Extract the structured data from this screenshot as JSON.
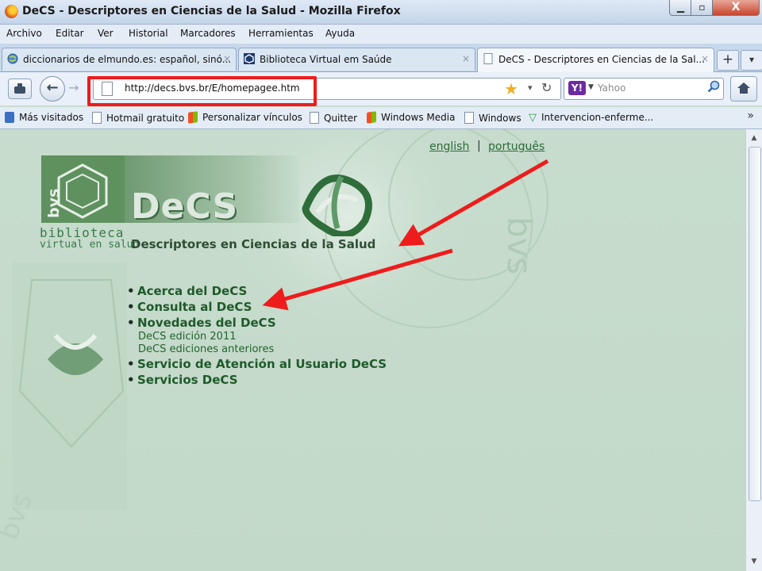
{
  "window": {
    "title": "DeCS - Descriptores en Ciencias de la Salud - Mozilla Firefox",
    "minimize": "▁",
    "maximize": "▫",
    "close": "X"
  },
  "menubar": {
    "items": [
      "Archivo",
      "Editar",
      "Ver",
      "Historial",
      "Marcadores",
      "Herramientas",
      "Ayuda"
    ]
  },
  "tabs": [
    {
      "label": "diccionarios de elmundo.es: español, sinó...",
      "close": "×"
    },
    {
      "label": "Biblioteca Virtual em Saúde",
      "close": "×"
    },
    {
      "label": "DeCS - Descriptores en Ciencias de la Sal...",
      "close": "×"
    }
  ],
  "tabstrip": {
    "new_tab": "+",
    "list_all": "▾"
  },
  "navbar": {
    "url": "http://decs.bvs.br/E/homepagee.htm",
    "search_placeholder": "Yahoo",
    "search_engine": "Y!",
    "search_drop": "▼"
  },
  "bookmarks": [
    {
      "label": "Más visitados",
      "icon": "blue"
    },
    {
      "label": "Hotmail gratuito",
      "icon": "page"
    },
    {
      "label": "Personalizar vínculos",
      "icon": "windows"
    },
    {
      "label": "Quitter",
      "icon": "page"
    },
    {
      "label": "Windows Media",
      "icon": "windows"
    },
    {
      "label": "Windows",
      "icon": "page"
    },
    {
      "label": "Intervencion-enferme...",
      "icon": "triangle"
    }
  ],
  "bookmarks_more": "»",
  "page": {
    "lang_english": "english",
    "lang_separator": "|",
    "lang_portugues": "português",
    "logo_bvs": "bvs",
    "logo_biblioteca": "biblioteca",
    "logo_virtual": "virtual en salud",
    "title": "DeCS",
    "subtitle": "Descriptores en Ciencias de la Salud",
    "menu": {
      "acerca": "Acerca del DeCS",
      "consulta": "Consulta al DeCS",
      "novedades": "Novedades del DeCS",
      "edicion_2011": "DeCS edición 2011",
      "ediciones_anteriores": "DeCS ediciones anteriores",
      "servicio": "Servicio de Atención al Usuario DeCS",
      "servicios": "Servicios DeCS"
    }
  },
  "colors": {
    "annotation_red": "#ee1c1c",
    "page_background": "#c7dccd",
    "link_green": "#1f5a2b"
  }
}
